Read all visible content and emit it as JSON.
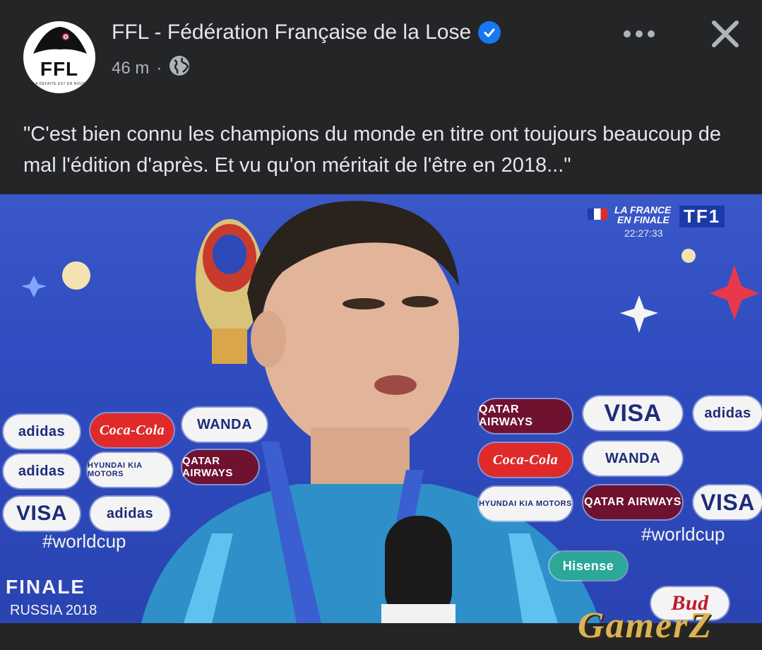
{
  "post": {
    "page_name": "FFL - Fédération Française de la Lose",
    "timestamp": "46 m",
    "separator": "·",
    "privacy_icon": "globe-icon",
    "text": "\"C'est bien connu les champions du monde en titre ont toujours beaucoup de mal l'édition d'après. Et vu qu'on méritait de l'être en 2018...\"",
    "avatar": {
      "label": "FFL",
      "motto": "LA DÉFAITE EST EN NOUS"
    }
  },
  "actions": {
    "more_icon": "more-horizontal-icon",
    "close_icon": "close-icon"
  },
  "media": {
    "broadcast": {
      "headline_1": "LA FRANCE",
      "headline_2": "EN FINALE",
      "time": "22:27:33",
      "channel": "TF1"
    },
    "lower_left": {
      "line1": "FINALE",
      "line2": "RUSSIA 2018"
    },
    "hashtag": "#worldcup",
    "sponsors": [
      "adidas",
      "Coca-Cola",
      "WANDA",
      "QATAR AIRWAYS",
      "VISA",
      "HYUNDAI KIA MOTORS",
      "Hisense",
      "Bud"
    ]
  },
  "watermark": "GamerZ",
  "colors": {
    "background": "#242526",
    "text": "#e4e6eb",
    "secondary_text": "#b0b3b8",
    "verified": "#1877f2",
    "board_blue": "#2f4cc0"
  }
}
